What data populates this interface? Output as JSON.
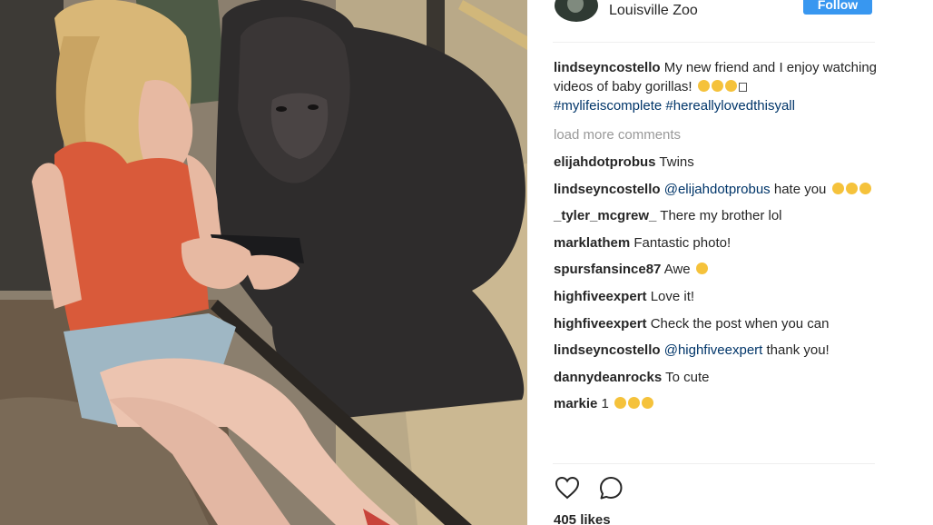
{
  "header": {
    "location": "Louisville Zoo",
    "follow_label": "Follow"
  },
  "caption": {
    "username": "lindseyncostello",
    "text": " My new friend and I enjoy watching videos of baby gorillas! ",
    "hashtag1": "#mylifeiscomplete",
    "hashtag2": "#hereallylovedthisyall"
  },
  "load_more": "load more comments",
  "comments": [
    {
      "user": "elijahdotprobus",
      "text": " Twins"
    },
    {
      "user": "lindseyncostello",
      "mention": "@elijahdotprobus",
      "text": " hate you "
    },
    {
      "user": "_tyler_mcgrew_",
      "text": " There my brother lol"
    },
    {
      "user": "marklathem",
      "text": " Fantastic photo!"
    },
    {
      "user": "spursfansince87",
      "text": " Awe "
    },
    {
      "user": "highfiveexpert",
      "text": " Love it!"
    },
    {
      "user": "highfiveexpert",
      "text": " Check the post when you can"
    },
    {
      "user": "lindseyncostello",
      "mention": "@highfiveexpert",
      "text": " thank you!"
    },
    {
      "user": "dannydeanrocks",
      "text": " To cute"
    },
    {
      "user": "markie",
      "text": " 1 "
    }
  ],
  "likes": "405 likes",
  "icons": [
    "heart-icon",
    "comment-icon",
    "emoji-icon"
  ],
  "colors": {
    "follow_button": "#3897f0",
    "link": "#003569",
    "muted": "#999999",
    "emoji": "#f5c23b"
  }
}
